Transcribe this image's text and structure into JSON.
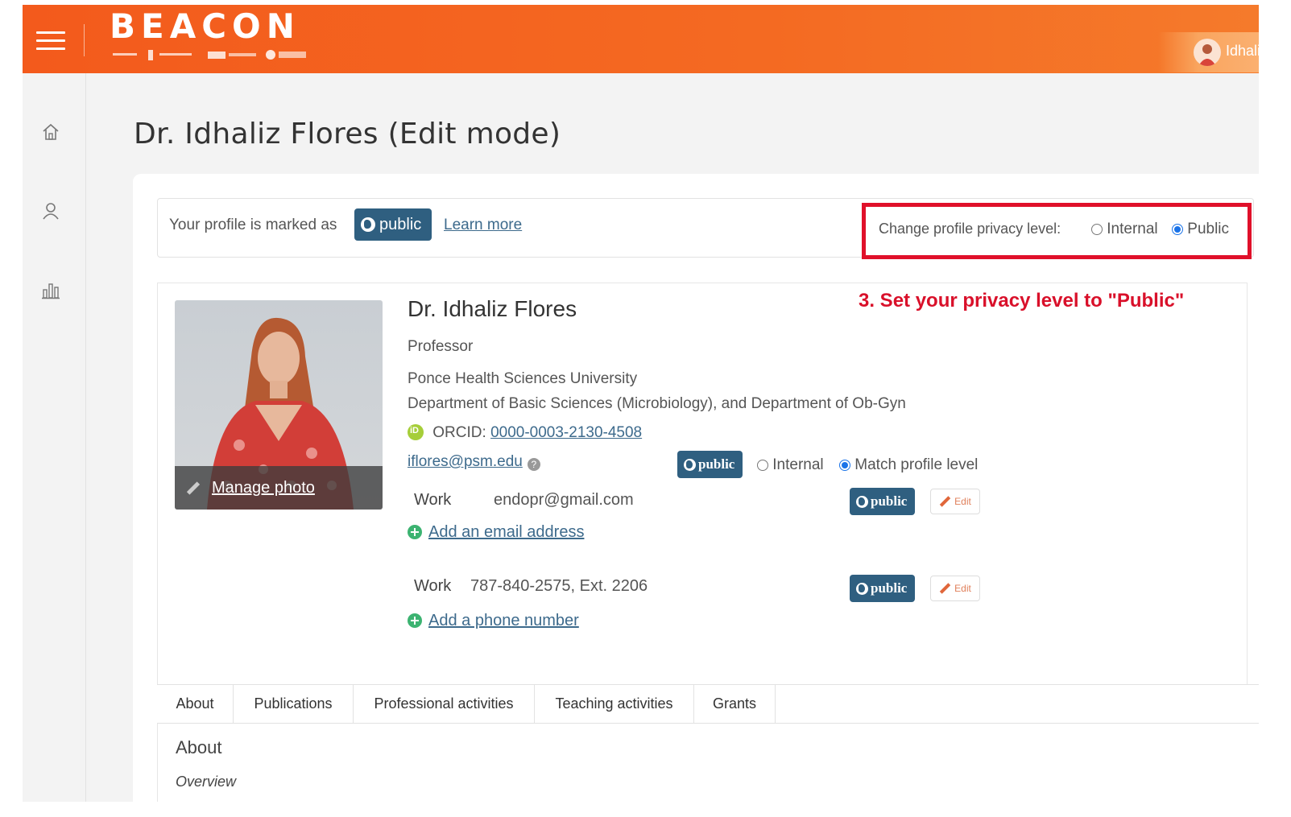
{
  "header": {
    "logo_text": "BEACON",
    "user_name": "Idhaliz"
  },
  "sidebar": {
    "items": [
      {
        "name": "home-icon"
      },
      {
        "name": "user-icon"
      },
      {
        "name": "chart-icon"
      }
    ]
  },
  "page": {
    "title": "Dr. Idhaliz Flores (Edit mode)"
  },
  "privacy": {
    "marked_text": "Your profile is marked as",
    "badge": "public",
    "learn_more": "Learn more",
    "change_label": "Change profile privacy level:",
    "opt_internal": "Internal",
    "opt_public": "Public",
    "selected": "Public"
  },
  "annotation": "3. Set your privacy level to \"Public\"",
  "profile": {
    "manage_photo": "Manage photo",
    "name": "Dr. Idhaliz Flores",
    "title": "Professor",
    "institution": "Ponce Health Sciences University",
    "department": "Department of Basic Sciences (Microbiology), and Department of Ob-Gyn",
    "orcid_label": "ORCID:",
    "orcid_value": "0000-0003-2130-4508",
    "primary_email": "iflores@psm.edu",
    "email_badge": "public",
    "email_opt_internal": "Internal",
    "email_opt_match": "Match profile level",
    "email_work_label": "Work",
    "email_work_value": "endopr@gmail.com",
    "email_work_badge": "public",
    "edit_label": "Edit",
    "add_email": "Add an email address",
    "phone_work_label": "Work",
    "phone_work_value": "787-840-2575, Ext. 2206",
    "phone_work_badge": "public",
    "add_phone": "Add a phone number"
  },
  "tabs": [
    "About",
    "Publications",
    "Professional activities",
    "Teaching activities",
    "Grants"
  ],
  "section": {
    "title": "About",
    "subtitle": "Overview"
  },
  "colors": {
    "header_orange": "#f35a1c",
    "badge_blue": "#2f5f80",
    "highlight_red": "#e0102a",
    "link_blue": "#3d6a8c"
  }
}
